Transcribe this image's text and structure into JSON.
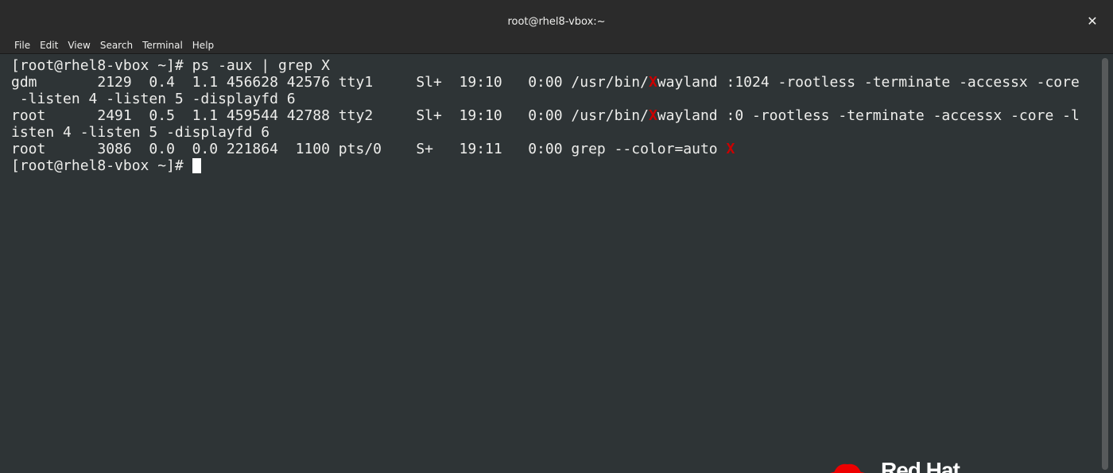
{
  "window": {
    "title": "root@rhel8-vbox:~",
    "close_glyph": "✕"
  },
  "menu": {
    "items": [
      "File",
      "Edit",
      "View",
      "Search",
      "Terminal",
      "Help"
    ]
  },
  "terminal": {
    "lines": [
      [
        {
          "t": "[root@rhel8-vbox ~]# ps -aux | grep X"
        }
      ],
      [
        {
          "t": "gdm       2129  0.4  1.1 456628 42576 tty1     Sl+  19:10   0:00 /usr/bin/"
        },
        {
          "t": "X",
          "hl": true
        },
        {
          "t": "wayland :1024 -rootless -terminate -accessx -core"
        }
      ],
      [
        {
          "t": " -listen 4 -listen 5 -displayfd 6"
        }
      ],
      [
        {
          "t": "root      2491  0.5  1.1 459544 42788 tty2     Sl+  19:10   0:00 /usr/bin/"
        },
        {
          "t": "X",
          "hl": true
        },
        {
          "t": "wayland :0 -rootless -terminate -accessx -core -l"
        }
      ],
      [
        {
          "t": "isten 4 -listen 5 -displayfd 6"
        }
      ],
      [
        {
          "t": "root      3086  0.0  0.0 221864  1100 pts/0    S+   19:11   0:00 grep --color=auto "
        },
        {
          "t": "X",
          "hl": true
        }
      ],
      [
        {
          "t": "[root@rhel8-vbox ~]# "
        },
        {
          "cursor": true
        }
      ]
    ],
    "highlight_color": "#cc0000",
    "background_color": "#2e3436",
    "foreground_color": "#eeeeec"
  },
  "watermark": {
    "text": "Red Hat",
    "logo_icon": "red-hat-logo-icon",
    "logo_color": "#ee0000"
  }
}
